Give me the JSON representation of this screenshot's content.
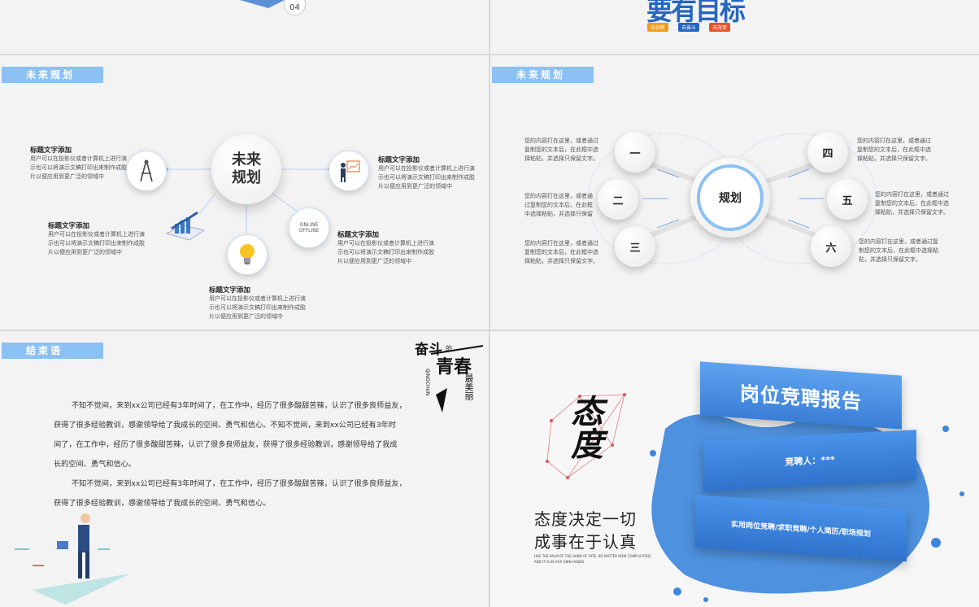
{
  "top_left": {
    "page_badge": "04"
  },
  "top_right": {
    "logo_text": "要有目标",
    "sub_badges": [
      "去创新",
      "去奋斗",
      "去改变"
    ],
    "badge_colors": [
      "#f39a1b",
      "#2466c3",
      "#e65424"
    ]
  },
  "mid_left": {
    "tag": "未来规划",
    "center": [
      "未来",
      "规划"
    ],
    "items": [
      {
        "title": "标题文字添加",
        "desc": [
          "用户可以在投影仪或者计算机上进行演",
          "示也可以将演示文稿打印出来制作成胶",
          "片以便应用到更广泛的领域中"
        ]
      },
      {
        "title": "标题文字添加",
        "desc": [
          "用户可以在投影仪或者计算机上进行演",
          "示也可以将演示文稿打印出来制作成胶",
          "片以便应用到更广泛的领域中"
        ]
      },
      {
        "title": "标题文字添加",
        "desc": [
          "用户可以在投影仪或者计算机上进行演",
          "示也可以将演示文稿打印出来制作成胶",
          "片以便应用到更广泛的领域中"
        ]
      },
      {
        "title": "标题文字添加",
        "desc": [
          "用户可以在投影仪或者计算机上进行演",
          "示也可以将演示文稿打印出来制作成胶",
          "片以便应用到更广泛的领域中"
        ]
      },
      {
        "title": "标题文字添加",
        "desc": [
          "用户可以在投影仪或者计算机上进行演",
          "示也可以将演示文稿打印出来制作成胶",
          "片以便应用到更广泛的领域中"
        ]
      }
    ],
    "laptop_words": [
      "ONLINE",
      "OFFLINE"
    ]
  },
  "mid_right": {
    "tag": "未来规划",
    "center": "规划",
    "nodes": [
      "一",
      "二",
      "三",
      "四",
      "五",
      "六"
    ],
    "texts": [
      [
        "您的内容打在这里，或者通过",
        "复制您的文本后，在此框中选",
        "择粘贴，并选择只保留文字。"
      ],
      [
        "您的内容打在这里，或者通",
        "过复制您的文本后，在此框",
        "中选择粘贴，并选择只保留"
      ],
      [
        "您的内容打在这里，或者通过",
        "复制您的文本后，在此框中选",
        "择粘贴，并选择只保留文字。"
      ],
      [
        "您的内容打在这里，或者通过",
        "复制您的文本后，在此框中选",
        "择粘贴，并选择只保留文字。"
      ],
      [
        "您的内容打在这里，或者通过",
        "复制您的文本后，在此框中选",
        "择粘贴，并选择只保留文字。"
      ],
      [
        "您的内容打在这里，或者通过复",
        "制您的文本后，在此框中选择粘",
        "贴，并选择只保留文字。"
      ]
    ]
  },
  "bot_left": {
    "tag": "结束语",
    "lines": [
      "不知不觉间，来到xx公司已经有3年时间了，在工作中，经历了很多酸甜苦辣，认识了很多良师益友，",
      "获得了很多经验教训，感谢领导给了我成长的空间、勇气和信心。不知不觉间，来到xx公司已经有3年时",
      "间了，在工作中，经历了很多酸甜苦辣，认识了很多良师益友，获得了很多经验教训，感谢领导给了我成",
      "长的空间、勇气和信心。",
      "不知不觉间，来到xx公司已经有3年时间了，在工作中，经历了很多酸甜苦辣，认识了很多良师益友，",
      "获得了很多经验教训，感谢领导给了我成长的空间、勇气和信心。"
    ],
    "calligraphy": {
      "a": "奋斗",
      "b": "的",
      "c": "青春",
      "d": "最美丽",
      "pinyin": "QINGCHUN"
    }
  },
  "bot_right": {
    "brush_title": "态度",
    "slogan": [
      "态度决定一切",
      "成事在于认真"
    ],
    "english": [
      "LIKE THE PALM OF THE HAND OF FATE, NO MATTER HOW COMPLICATED,",
      "AND IT IS IN OUR OWN HANDS."
    ],
    "title": "岗位竞聘报告",
    "presenter": "竞聘人：***",
    "subtitle": "实用岗位竞聘/求职竞聘/个人简历/职场规划",
    "accent": "#3c86dc"
  }
}
